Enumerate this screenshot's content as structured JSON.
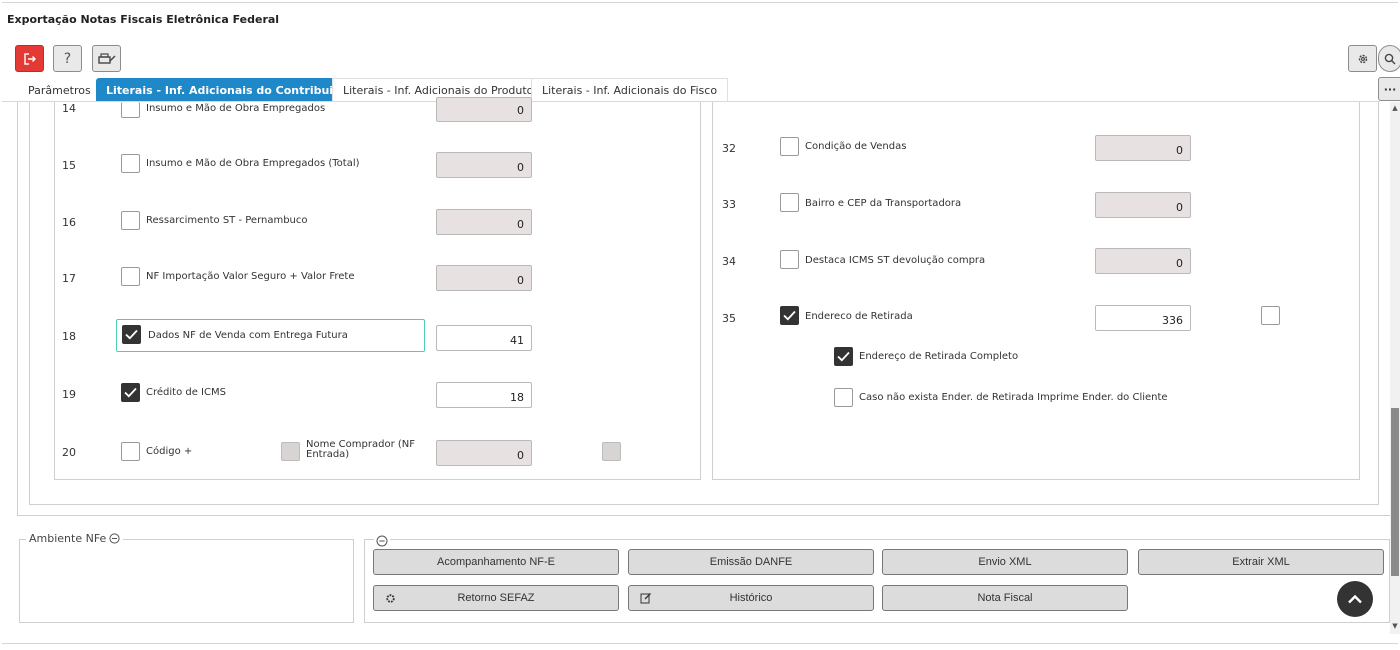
{
  "window": {
    "title": "Exportação Notas Fiscais Eletrônica Federal"
  },
  "toolbar": {
    "exit_icon": "exit-icon",
    "help_label": "?",
    "print_icon": "print-icon",
    "settings_icon": "gear-icon",
    "search_icon": "search-icon",
    "more_label": "···"
  },
  "tabs": [
    {
      "label": "Parâmetros"
    },
    {
      "label": "Literais - Inf. Adicionais do Contribuinte"
    },
    {
      "label": "Literais - Inf. Adicionais do Produto"
    },
    {
      "label": "Literais - Inf. Adicionais do Fisco"
    }
  ],
  "left_rows": [
    {
      "num": "14",
      "label": "Insumo e Mão de Obra Empregados",
      "checked": false,
      "value": "0"
    },
    {
      "num": "15",
      "label": "Insumo e Mão de Obra Empregados (Total)",
      "checked": false,
      "value": "0"
    },
    {
      "num": "16",
      "label": "Ressarcimento ST - Pernambuco",
      "checked": false,
      "value": "0"
    },
    {
      "num": "17",
      "label": "NF Importação Valor Seguro + Valor Frete",
      "checked": false,
      "value": "0"
    },
    {
      "num": "18",
      "label": "Dados NF de Venda com Entrega Futura",
      "checked": true,
      "value": "41"
    },
    {
      "num": "19",
      "label": "Crédito de ICMS",
      "checked": true,
      "value": "18"
    },
    {
      "num": "20",
      "label": "Código +",
      "checked": false,
      "value": "0",
      "extra_label": "Nome Comprador (NF Entrada)"
    }
  ],
  "right_rows": [
    {
      "num": "32",
      "label": "Condição de Vendas",
      "checked": false,
      "value": "0"
    },
    {
      "num": "33",
      "label": "Bairro e CEP da Transportadora",
      "checked": false,
      "value": "0"
    },
    {
      "num": "34",
      "label": "Destaca ICMS ST devolução compra",
      "checked": false,
      "value": "0"
    },
    {
      "num": "35",
      "label": "Endereco de Retirada",
      "checked": true,
      "value": "336"
    }
  ],
  "right_sub": [
    {
      "label": "Endereço de Retirada Completo",
      "checked": true
    },
    {
      "label": "Caso não exista Ender. de Retirada Imprime Ender. do Cliente",
      "checked": false
    }
  ],
  "ambiente": {
    "legend": "Ambiente NFe"
  },
  "actions": {
    "acompanhamento": "Acompanhamento NF-E",
    "emissao": "Emissão DANFE",
    "envio": "Envio XML",
    "extrair": "Extrair XML",
    "retorno": "Retorno SEFAZ",
    "historico": "Histórico",
    "nota": "Nota Fiscal"
  },
  "colors": {
    "accent": "#1e88c8",
    "exit": "#e53935",
    "focus": "#4dd0b0"
  }
}
